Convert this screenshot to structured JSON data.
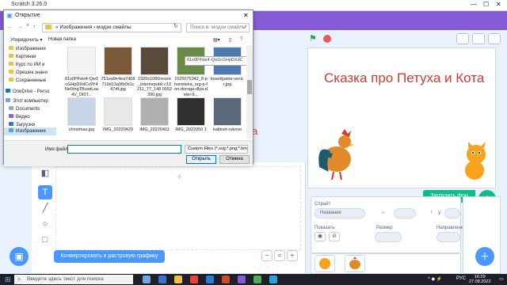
{
  "scratch": {
    "window_title": "Scratch 3.26.0",
    "stage_title_text": "Сказка про Петуха и Кота",
    "background_text_fragment": "а",
    "convert_button": "Конвертировать в растровую графику",
    "backdrop_tooltip": "Загрузить фон",
    "sprite_panel": {
      "sprite_label": "Спрайт",
      "name_placeholder": "Название",
      "x_label": "x",
      "y_label": "y",
      "show_label": "Показать",
      "size_label": "Размер",
      "direction_label": "Направление"
    },
    "zoom": {
      "minus": "−",
      "equal": "=",
      "plus": "+"
    }
  },
  "dialog": {
    "title": "Открытие",
    "breadcrumb": "«  Изображения  ›  модзи смайлы",
    "search_placeholder": "Поиск в: модзи смайлы",
    "toolbar": {
      "organize": "Упорядочить ▾",
      "new_folder": "Новая папка"
    },
    "nav_items": [
      "Изображения",
      "Картинки",
      "Курс по ИИ и",
      "Орешек знани",
      "Сохраненные",
      "OneDrive - Perso",
      "Этот компьютер",
      "Documents",
      "Видео",
      "Загрузки",
      "Изображения"
    ],
    "files": [
      {
        "name": "81x0PFws4-Qw1cGHpDXdCv9Y4Ne0mgTBuwtLxa4V_DI0T...",
        "color": "#f4f4f4"
      },
      {
        "name": "751ea9e4ea7d68719d13a9fb0b1c474f.jpg",
        "color": "#7a5a3a"
      },
      {
        "name": "1920x1080resize_interiorpubli c13211_77_148 0052390.jpg",
        "color": "#5a4a3a"
      },
      {
        "name": "1620075342_8-phoneteka_org-p-fon-doroga-dlya-detei-9...",
        "color": "#6a8a4a"
      },
      {
        "name": "boardgame-vector.jpg",
        "color": "#4a7ab0"
      },
      {
        "name": "christmas.jpg",
        "color": "#c8d4e8"
      },
      {
        "name": "IMG_20220429",
        "color": "#e8e8e8"
      },
      {
        "name": "IMG_20220411",
        "color": "#b0b0b0"
      },
      {
        "name": "IMG_2022050 1",
        "color": "#303030"
      },
      {
        "name": "kabinet-rukovo",
        "color": "#5a6a7a"
      }
    ],
    "hover_tooltip": "81x0PFws4-Qw1cGHpDXdC",
    "filename_label": "Имя файла:",
    "filename_value": "",
    "file_type": "Custom Files (*.svg;*.png;*.bmp;*",
    "open_button": "Открыть",
    "cancel_button": "Отмена"
  },
  "taskbar": {
    "search_placeholder": "Введите здесь текст для поиска",
    "language": "РУС",
    "time": "16:29",
    "date": "27.08.2022"
  },
  "colors": {
    "scratch_purple": "#855cd6",
    "scratch_blue": "#4c97ff",
    "scratch_green": "#0fbd8c",
    "title_red": "#d63a2e"
  }
}
